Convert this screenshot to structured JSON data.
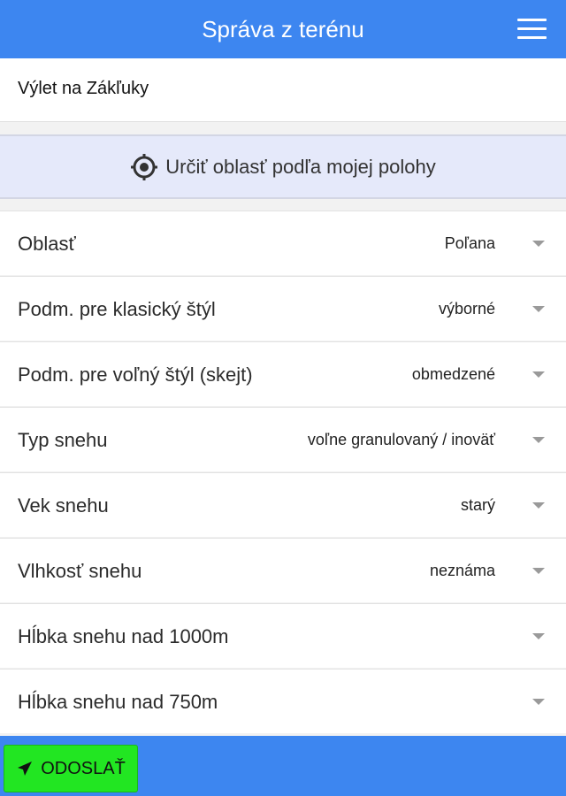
{
  "header": {
    "title": "Správa z terénu",
    "menu_icon": "hamburger-menu-icon"
  },
  "trip": {
    "value": "Výlet na Zákľuky"
  },
  "locate": {
    "label": "Určiť oblasť podľa mojej polohy",
    "icon": "crosshair-target-icon"
  },
  "fields": [
    {
      "label": "Oblasť",
      "value": "Poľana"
    },
    {
      "label": "Podm. pre klasický štýl",
      "value": "výborné"
    },
    {
      "label": "Podm. pre voľný štýl (skejt)",
      "value": "obmedzené"
    },
    {
      "label": "Typ snehu",
      "value": "voľne granulovaný / inoväť"
    },
    {
      "label": "Vek snehu",
      "value": "starý"
    },
    {
      "label": "Vlhkosť snehu",
      "value": "neznáma"
    },
    {
      "label": "Hĺbka snehu nad 1000m",
      "value": ""
    },
    {
      "label": "Hĺbka snehu nad 750m",
      "value": ""
    }
  ],
  "footer": {
    "send_label": "ODOSLAŤ",
    "send_icon": "paper-plane-icon"
  },
  "colors": {
    "header_bg": "#3d86f0",
    "locate_bg": "#e5e9fa",
    "send_bg": "#22e622"
  }
}
